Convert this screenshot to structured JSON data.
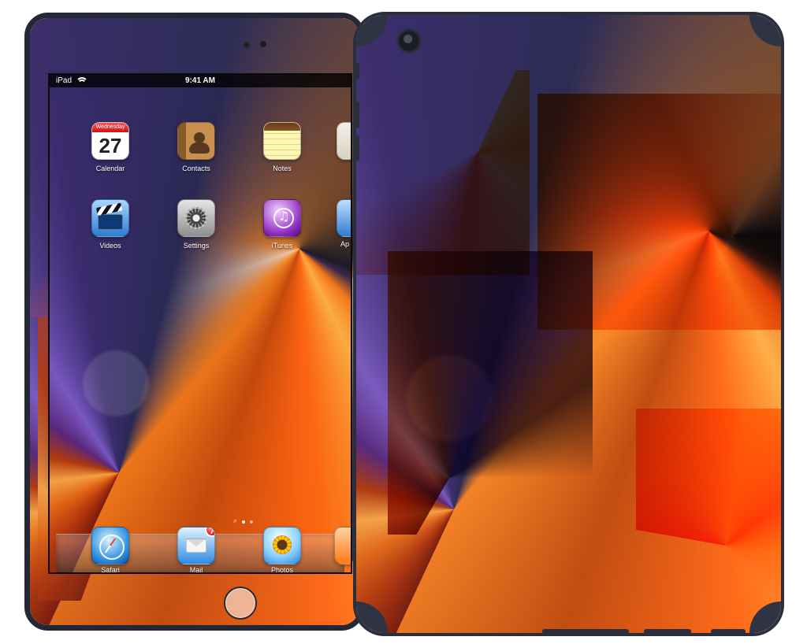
{
  "status_bar": {
    "device": "iPad",
    "time": "9:41 AM"
  },
  "home_screen": {
    "apps": [
      {
        "label": "Calendar",
        "icon": "calendar-icon",
        "calendar_weekday": "Wednesday",
        "calendar_day": "27"
      },
      {
        "label": "Contacts",
        "icon": "contacts-icon"
      },
      {
        "label": "Notes",
        "icon": "notes-icon"
      },
      {
        "label": "Videos",
        "icon": "videos-icon"
      },
      {
        "label": "Settings",
        "icon": "settings-icon"
      },
      {
        "label": "iTunes",
        "icon": "itunes-icon"
      }
    ],
    "edge_partial_labels": [
      "Ap"
    ]
  },
  "page_indicator": {
    "search_glyph": "⌕",
    "pages": 2,
    "active_page": 1
  },
  "dock": {
    "apps": [
      {
        "label": "Safari",
        "icon": "safari-icon"
      },
      {
        "label": "Mail",
        "icon": "mail-icon",
        "badge": "7"
      },
      {
        "label": "Photos",
        "icon": "photos-icon"
      }
    ]
  },
  "colors": {
    "device_trim": "#242836",
    "back_trim": "#2b2f3d"
  }
}
